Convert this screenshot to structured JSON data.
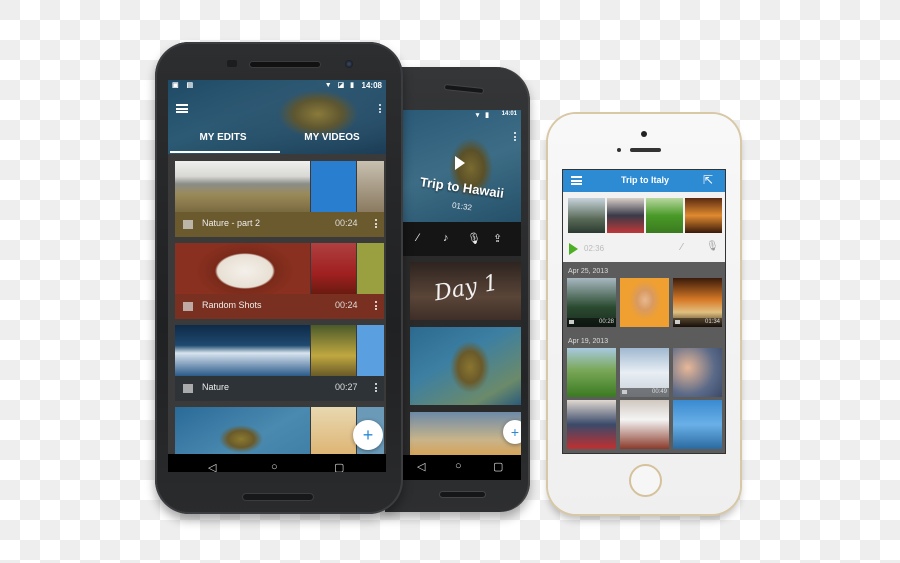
{
  "phone_android_front": {
    "status": {
      "time": "14:08"
    },
    "tabs": [
      {
        "label": "MY EDITS",
        "active": true
      },
      {
        "label": "MY VIDEOS",
        "active": false
      }
    ],
    "cards": [
      {
        "title": "Nature - part 2",
        "duration": "00:24",
        "bar_color": "#6b5a2e"
      },
      {
        "title": "Random Shots",
        "duration": "00:24",
        "bar_color": "#7a3020"
      },
      {
        "title": "Nature",
        "duration": "00:27",
        "bar_color": "#2e3338"
      }
    ],
    "fab_label": "+",
    "nav": {
      "back": "◁",
      "home": "○",
      "recents": "▢"
    }
  },
  "phone_android_back": {
    "status": {
      "time": "14:01"
    },
    "hero": {
      "title": "Trip to Hawaii",
      "duration": "01:32"
    },
    "toolbar_icons": [
      "magic-wand",
      "music-note",
      "microphone",
      "upload"
    ],
    "clips": [
      {
        "caption": "Day 1"
      }
    ],
    "fab_label": "+",
    "nav": {
      "back": "◁",
      "home": "○",
      "recents": "▢"
    }
  },
  "phone_iphone": {
    "title": "Trip to Italy",
    "player": {
      "duration": "02:36"
    },
    "sections": [
      {
        "date": "Apr 25, 2013",
        "items": [
          {
            "type": "video",
            "duration": "00:28"
          },
          {
            "type": "photo"
          },
          {
            "type": "video",
            "duration": "01:34"
          }
        ]
      },
      {
        "date": "Apr 19, 2013",
        "items": [
          {
            "type": "photo"
          },
          {
            "type": "video",
            "duration": "00:49"
          },
          {
            "type": "photo"
          },
          {
            "type": "photo"
          },
          {
            "type": "photo"
          },
          {
            "type": "photo"
          }
        ]
      }
    ],
    "accent_color": "#2d8bd3"
  }
}
